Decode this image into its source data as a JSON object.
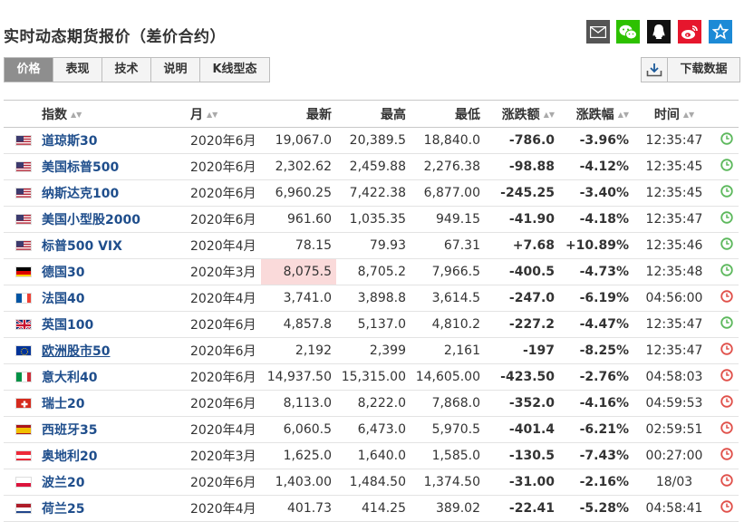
{
  "page": {
    "title": "实时动态期货报价（差价合约）"
  },
  "share_icons": [
    {
      "name": "email-icon",
      "color": "#555555"
    },
    {
      "name": "wechat-icon",
      "color": "#2dc100"
    },
    {
      "name": "qq-icon",
      "color": "#111111"
    },
    {
      "name": "weibo-icon",
      "color": "#e6162d"
    },
    {
      "name": "star-icon",
      "color": "#1c8ad6"
    }
  ],
  "tabs": [
    "价格",
    "表现",
    "技术",
    "说明",
    "K线型态"
  ],
  "active_tab": 0,
  "download": {
    "label": "下载数据",
    "icon": "download-icon"
  },
  "table": {
    "headers": {
      "index": "指数",
      "month": "月",
      "last": "最新",
      "high": "最高",
      "low": "最低",
      "chg": "涨跌额",
      "chg_pct": "涨跌幅",
      "time": "时间"
    },
    "rows": [
      {
        "flag": "us",
        "name": "道琼斯30",
        "month": "2020年6月",
        "last": "19,067.0",
        "high": "20,389.5",
        "low": "18,840.0",
        "chg": "-786.0",
        "pct": "-3.96%",
        "time": "12:35:47",
        "dir": "neg",
        "status": "open"
      },
      {
        "flag": "us",
        "name": "美国标普500",
        "month": "2020年6月",
        "last": "2,302.62",
        "high": "2,459.88",
        "low": "2,276.38",
        "chg": "-98.88",
        "pct": "-4.12%",
        "time": "12:35:45",
        "dir": "neg",
        "status": "open"
      },
      {
        "flag": "us",
        "name": "纳斯达克100",
        "month": "2020年6月",
        "last": "6,960.25",
        "high": "7,422.38",
        "low": "6,877.00",
        "chg": "-245.25",
        "pct": "-3.40%",
        "time": "12:35:45",
        "dir": "neg",
        "status": "open"
      },
      {
        "flag": "us",
        "name": "美国小型股2000",
        "month": "2020年6月",
        "last": "961.60",
        "high": "1,035.35",
        "low": "949.15",
        "chg": "-41.90",
        "pct": "-4.18%",
        "time": "12:35:47",
        "dir": "neg",
        "status": "open"
      },
      {
        "flag": "us",
        "name": "标普500 VIX",
        "month": "2020年4月",
        "last": "78.15",
        "high": "79.93",
        "low": "67.31",
        "chg": "+7.68",
        "pct": "+10.89%",
        "time": "12:35:46",
        "dir": "pos",
        "status": "open"
      },
      {
        "flag": "de",
        "name": "德国30",
        "month": "2020年3月",
        "last": "8,075.5",
        "high": "8,705.2",
        "low": "7,966.5",
        "chg": "-400.5",
        "pct": "-4.73%",
        "time": "12:35:48",
        "dir": "neg",
        "status": "open",
        "highlight": true
      },
      {
        "flag": "fr",
        "name": "法国40",
        "month": "2020年4月",
        "last": "3,741.0",
        "high": "3,898.8",
        "low": "3,614.5",
        "chg": "-247.0",
        "pct": "-6.19%",
        "time": "04:56:00",
        "dir": "neg",
        "status": "closed"
      },
      {
        "flag": "gb",
        "name": "英国100",
        "month": "2020年6月",
        "last": "4,857.8",
        "high": "5,137.0",
        "low": "4,810.2",
        "chg": "-227.2",
        "pct": "-4.47%",
        "time": "12:35:47",
        "dir": "neg",
        "status": "open"
      },
      {
        "flag": "eu",
        "name": "欧洲股市50",
        "month": "2020年6月",
        "last": "2,192",
        "high": "2,399",
        "low": "2,161",
        "chg": "-197",
        "pct": "-8.25%",
        "time": "12:35:47",
        "dir": "neg",
        "status": "closed",
        "underline": true
      },
      {
        "flag": "it",
        "name": "意大利40",
        "month": "2020年6月",
        "last": "14,937.50",
        "high": "15,315.00",
        "low": "14,605.00",
        "chg": "-423.50",
        "pct": "-2.76%",
        "time": "04:58:03",
        "dir": "neg",
        "status": "closed"
      },
      {
        "flag": "ch",
        "name": "瑞士20",
        "month": "2020年6月",
        "last": "8,113.0",
        "high": "8,222.0",
        "low": "7,868.0",
        "chg": "-352.0",
        "pct": "-4.16%",
        "time": "04:59:53",
        "dir": "neg",
        "status": "closed"
      },
      {
        "flag": "es",
        "name": "西班牙35",
        "month": "2020年4月",
        "last": "6,060.5",
        "high": "6,473.0",
        "low": "5,970.5",
        "chg": "-401.4",
        "pct": "-6.21%",
        "time": "02:59:51",
        "dir": "neg",
        "status": "closed"
      },
      {
        "flag": "at",
        "name": "奥地利20",
        "month": "2020年3月",
        "last": "1,625.0",
        "high": "1,640.0",
        "low": "1,585.0",
        "chg": "-130.5",
        "pct": "-7.43%",
        "time": "00:27:00",
        "dir": "neg",
        "status": "closed"
      },
      {
        "flag": "pl",
        "name": "波兰20",
        "month": "2020年6月",
        "last": "1,403.00",
        "high": "1,484.50",
        "low": "1,374.50",
        "chg": "-31.00",
        "pct": "-2.16%",
        "time": "18/03",
        "dir": "neg",
        "status": "closed"
      },
      {
        "flag": "nl",
        "name": "荷兰25",
        "month": "2020年4月",
        "last": "401.73",
        "high": "414.25",
        "low": "389.02",
        "chg": "-22.41",
        "pct": "-5.28%",
        "time": "04:58:41",
        "dir": "neg",
        "status": "closed"
      }
    ]
  },
  "colors": {
    "negative": "#2aa12a",
    "positive": "#e52a2a",
    "link": "#1f4e8c",
    "open_clock": "#5cb85c",
    "closed_clock": "#e0504a",
    "highlight": "#fadada"
  }
}
